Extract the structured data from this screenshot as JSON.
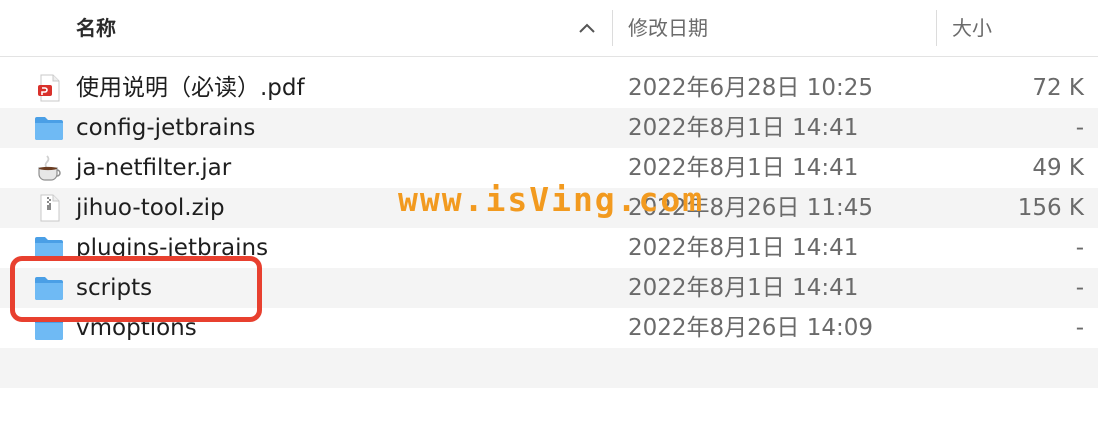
{
  "header": {
    "name_label": "名称",
    "date_label": "修改日期",
    "size_label": "大小"
  },
  "files": [
    {
      "name": "使用说明（必读）.pdf",
      "date": "2022年6月28日 10:25",
      "size": "72 K",
      "icon": "pdf-icon"
    },
    {
      "name": "config-jetbrains",
      "date": "2022年8月1日 14:41",
      "size": "-",
      "icon": "folder-icon"
    },
    {
      "name": "ja-netfilter.jar",
      "date": "2022年8月1日 14:41",
      "size": "49 K",
      "icon": "java-jar-icon"
    },
    {
      "name": "jihuo-tool.zip",
      "date": "2022年8月26日 11:45",
      "size": "156 K",
      "icon": "zip-icon"
    },
    {
      "name": "plugins-jetbrains",
      "date": "2022年8月1日 14:41",
      "size": "-",
      "icon": "folder-icon"
    },
    {
      "name": "scripts",
      "date": "2022年8月1日 14:41",
      "size": "-",
      "icon": "folder-icon"
    },
    {
      "name": "vmoptions",
      "date": "2022年8月26日 14:09",
      "size": "-",
      "icon": "folder-icon"
    }
  ],
  "watermark": "www.isVing.com",
  "colors": {
    "folder": "#5aaef0",
    "highlight": "#e8402f",
    "watermark": "#f29a1f",
    "pdf": "#d9312b"
  }
}
